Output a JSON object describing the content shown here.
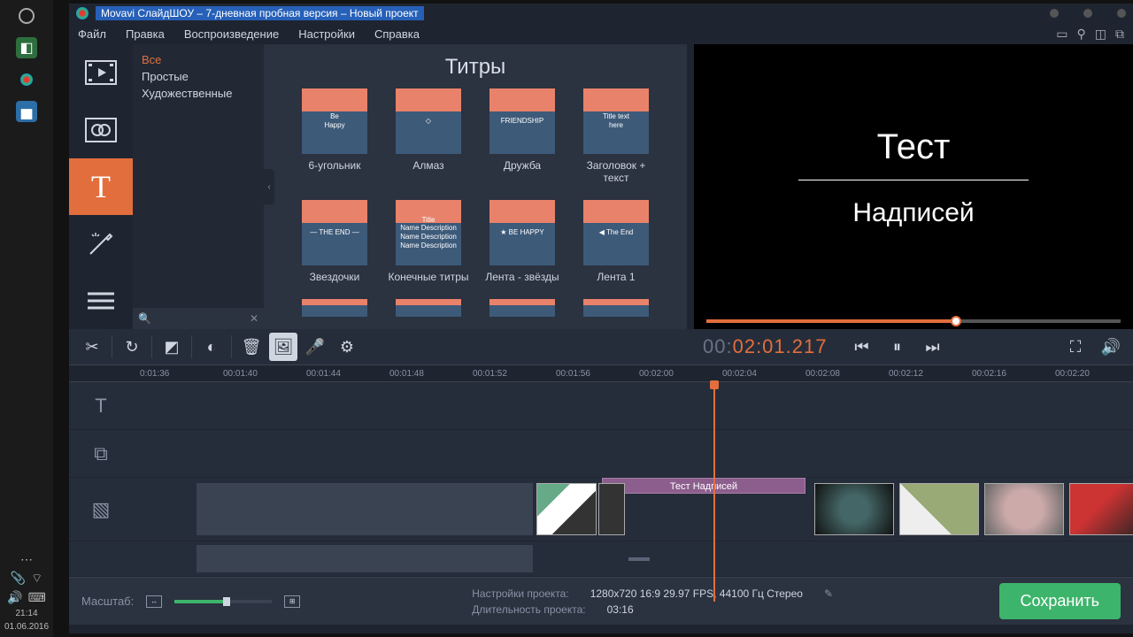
{
  "titlebar": {
    "text": "Movavi СлайдШОУ – 7-дневная пробная версия – Новый проект"
  },
  "menu": {
    "file": "Файл",
    "edit": "Правка",
    "playback": "Воспроизведение",
    "settings": "Настройки",
    "help": "Справка"
  },
  "gallery": {
    "title": "Титры",
    "categories": {
      "all": "Все",
      "simple": "Простые",
      "artistic": "Художественные"
    },
    "items": [
      {
        "label": "6-угольник",
        "th": "Be\nHappy"
      },
      {
        "label": "Алмаз",
        "th": "◇"
      },
      {
        "label": "Дружба",
        "th": "FRIENDSHIP"
      },
      {
        "label": "Заголовок + текст",
        "th": "Title text\nhere"
      },
      {
        "label": "Звездочки",
        "th": "— THE END —"
      },
      {
        "label": "Конечные титры",
        "th": "Title\nName Description\nName Description\nName Description"
      },
      {
        "label": "Лента - звёзды",
        "th": "★ BE HAPPY"
      },
      {
        "label": "Лента 1",
        "th": "◀ The End"
      }
    ]
  },
  "preview": {
    "title": "Тест",
    "subtitle": "Надписей"
  },
  "timecode": {
    "pre": "00:",
    "main": "02:01.217"
  },
  "ruler": [
    "0:01:36",
    "00:01:40",
    "00:01:44",
    "00:01:48",
    "00:01:52",
    "00:01:56",
    "00:02:00",
    "00:02:04",
    "00:02:08",
    "00:02:12",
    "00:02:16",
    "00:02:20"
  ],
  "title_clip": "Тест Надписей",
  "bottom": {
    "zoom_label": "Масштаб:",
    "proj_settings_label": "Настройки проекта:",
    "proj_settings_value": "1280x720 16:9 29.97 FPS, 44100 Гц Стерео",
    "duration_label": "Длительность проекта:",
    "duration_value": "03:16",
    "save": "Сохранить"
  },
  "clock": {
    "time": "21:14",
    "date": "01.06.2016"
  }
}
